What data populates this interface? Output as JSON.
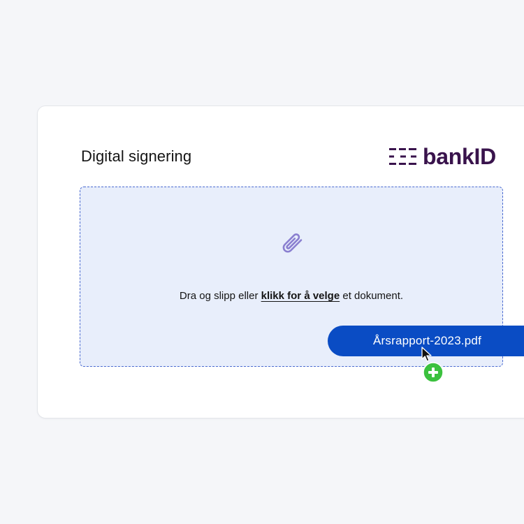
{
  "card": {
    "title": "Digital signering",
    "logo_text": "bankID"
  },
  "dropzone": {
    "icon": "paperclip-icon",
    "text_before": "Dra og slipp eller ",
    "link_text": "klikk for å velge",
    "text_after": " et dokument."
  },
  "drag": {
    "file_name": "Årsrapport-2023.pdf",
    "cursor_icon": "arrow-cursor-icon",
    "badge_icon": "plus-circle-icon"
  },
  "colors": {
    "page_background": "#f5f6f9",
    "card_background": "#ffffff",
    "brand": "#39134c",
    "dropzone_fill": "#e8eefb",
    "dropzone_border": "#4a6ad0",
    "paperclip": "#8a7fd0",
    "file_pill": "#0a4cc4",
    "add_badge": "#3bc13e"
  }
}
